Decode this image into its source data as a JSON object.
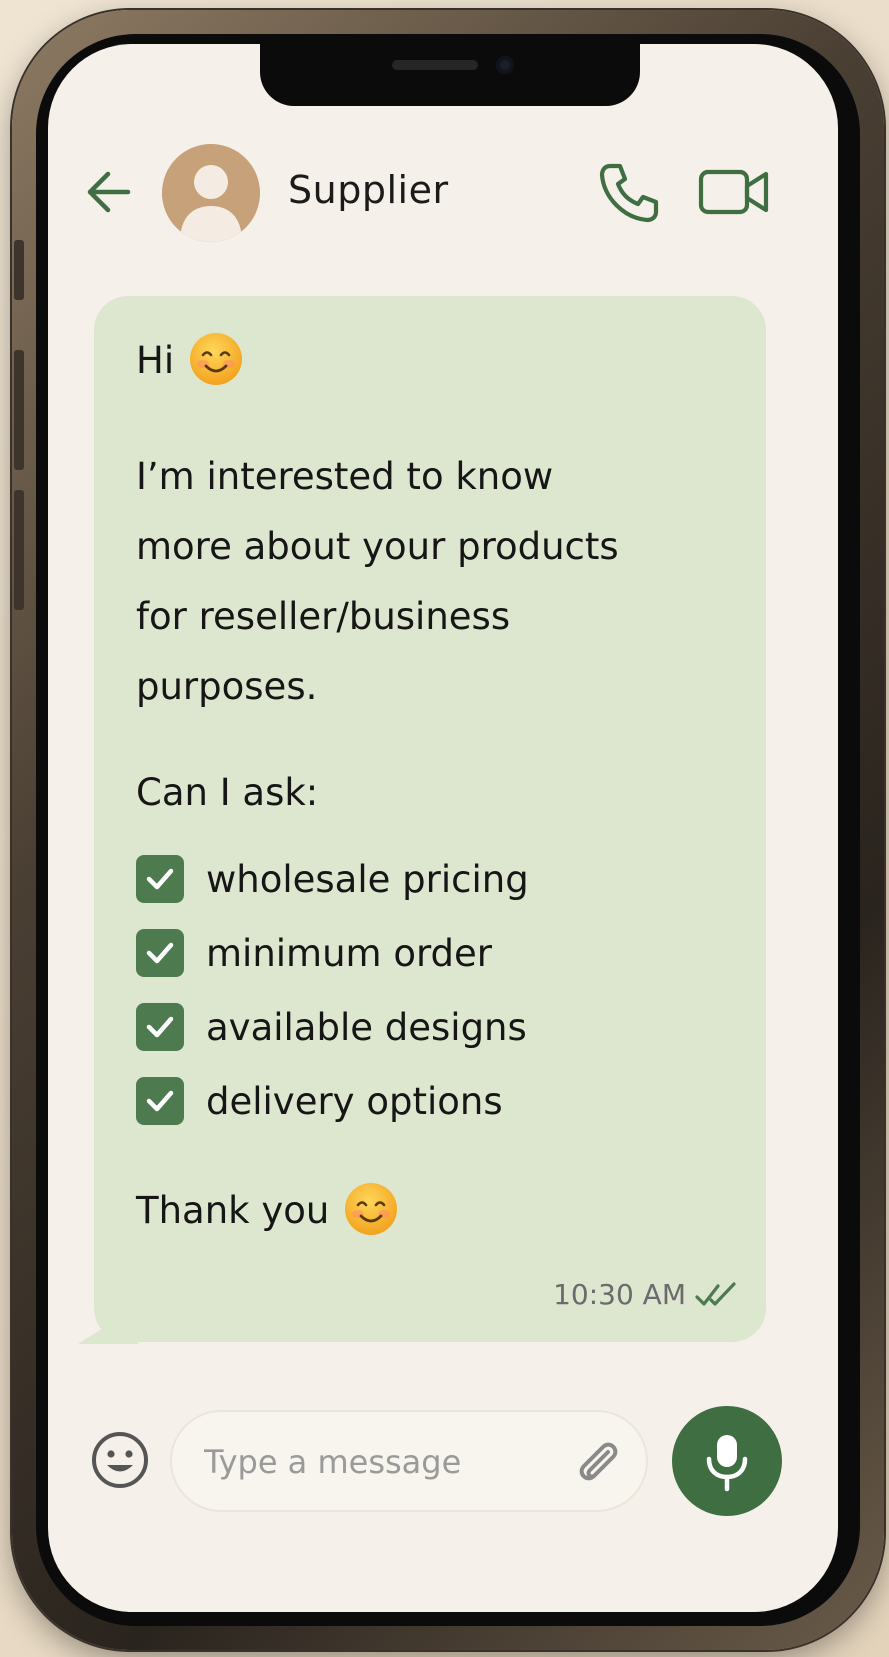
{
  "header": {
    "contact_name": "Supplier",
    "back_icon": "arrow-left-icon",
    "call_icon": "phone-icon",
    "video_icon": "video-camera-icon",
    "accent_color": "#3f6e42"
  },
  "message": {
    "greeting": "Hi",
    "greeting_emoji": "smiling-face-icon",
    "paragraph_lines": [
      "I’m interested to know",
      "more about your products",
      "for reseller/business",
      "purposes."
    ],
    "ask": "Can I ask:",
    "checklist": [
      "wholesale pricing",
      "minimum order",
      "available designs",
      "delivery options"
    ],
    "closing": "Thank you",
    "closing_emoji": "smiling-face-icon",
    "timestamp": "10:30 AM",
    "status_icon": "double-check-icon",
    "bubble_color": "#dde6cf"
  },
  "composer": {
    "placeholder": "Type a message",
    "value": "",
    "emoji_icon": "emoji-icon",
    "attach_icon": "paperclip-icon",
    "mic_icon": "microphone-icon"
  }
}
